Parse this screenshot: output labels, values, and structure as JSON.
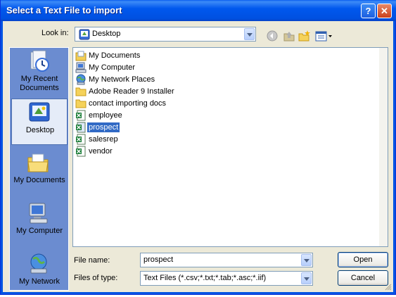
{
  "window": {
    "title": "Select a Text File to import",
    "help_glyph": "?",
    "close_glyph": "✕"
  },
  "toolbar": {
    "look_in_label": "Look in:",
    "look_in_value": "Desktop",
    "icons": [
      "back-icon",
      "up-folder-icon",
      "new-folder-icon",
      "views-menu-icon"
    ]
  },
  "places": [
    {
      "label": "My Recent Documents",
      "icon": "recent-documents-icon",
      "selected": false
    },
    {
      "label": "Desktop",
      "icon": "desktop-icon",
      "selected": true
    },
    {
      "label": "My Documents",
      "icon": "my-documents-icon",
      "selected": false
    },
    {
      "label": "My Computer",
      "icon": "my-computer-icon",
      "selected": false
    },
    {
      "label": "My Network",
      "icon": "my-network-icon",
      "selected": false
    }
  ],
  "files": [
    {
      "name": "My Documents",
      "icon": "my-documents-icon"
    },
    {
      "name": "My Computer",
      "icon": "my-computer-icon"
    },
    {
      "name": "My Network Places",
      "icon": "network-places-icon"
    },
    {
      "name": "Adobe Reader 9 Installer",
      "icon": "folder-icon"
    },
    {
      "name": "contact importing docs",
      "icon": "folder-icon"
    },
    {
      "name": "employee",
      "icon": "text-file-icon"
    },
    {
      "name": "prospect",
      "icon": "text-file-icon",
      "selected": true
    },
    {
      "name": "salesrep",
      "icon": "text-file-icon"
    },
    {
      "name": "vendor",
      "icon": "text-file-icon"
    }
  ],
  "footer": {
    "file_name_label": "File name:",
    "file_name_value": "prospect",
    "file_type_label": "Files of type:",
    "file_type_value": "Text Files (*.csv;*.txt;*.tab;*.asc;*.iif)",
    "open_label": "Open",
    "cancel_label": "Cancel"
  },
  "colors": {
    "titlebar": "#0054e3",
    "dialog_bg": "#ece9d8",
    "places_bar": "#6b8cd0",
    "selection": "#316ac5"
  }
}
